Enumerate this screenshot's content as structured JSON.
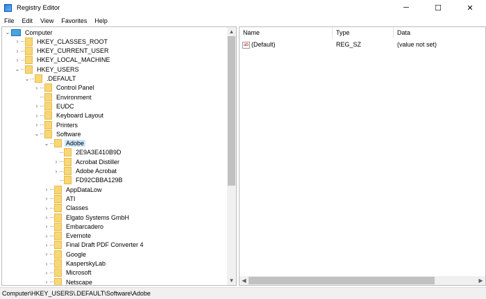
{
  "window": {
    "title": "Registry Editor",
    "minimize": "─",
    "maximize": "☐",
    "close": "✕"
  },
  "menu": [
    "File",
    "Edit",
    "View",
    "Favorites",
    "Help"
  ],
  "tree": [
    {
      "label": "Computer",
      "level": 0,
      "state": "open",
      "icon": "computer"
    },
    {
      "label": "HKEY_CLASSES_ROOT",
      "level": 1,
      "state": "closed"
    },
    {
      "label": "HKEY_CURRENT_USER",
      "level": 1,
      "state": "closed"
    },
    {
      "label": "HKEY_LOCAL_MACHINE",
      "level": 1,
      "state": "closed"
    },
    {
      "label": "HKEY_USERS",
      "level": 1,
      "state": "open"
    },
    {
      "label": ".DEFAULT",
      "level": 2,
      "state": "open"
    },
    {
      "label": "Control Panel",
      "level": 3,
      "state": "closed"
    },
    {
      "label": "Environment",
      "level": 3,
      "state": "leaf"
    },
    {
      "label": "EUDC",
      "level": 3,
      "state": "closed"
    },
    {
      "label": "Keyboard Layout",
      "level": 3,
      "state": "closed"
    },
    {
      "label": "Printers",
      "level": 3,
      "state": "closed"
    },
    {
      "label": "Software",
      "level": 3,
      "state": "open"
    },
    {
      "label": "Adobe",
      "level": 4,
      "state": "open",
      "selected": true
    },
    {
      "label": "2E9A3E410B9D",
      "level": 5,
      "state": "leaf"
    },
    {
      "label": "Acrobat Distiller",
      "level": 5,
      "state": "closed"
    },
    {
      "label": "Adobe Acrobat",
      "level": 5,
      "state": "closed"
    },
    {
      "label": "FD92CBBA129B",
      "level": 5,
      "state": "leaf"
    },
    {
      "label": "AppDataLow",
      "level": 4,
      "state": "closed"
    },
    {
      "label": "ATI",
      "level": 4,
      "state": "closed"
    },
    {
      "label": "Classes",
      "level": 4,
      "state": "closed"
    },
    {
      "label": "Elgato Systems GmbH",
      "level": 4,
      "state": "closed"
    },
    {
      "label": "Embarcadero",
      "level": 4,
      "state": "closed"
    },
    {
      "label": "Evernote",
      "level": 4,
      "state": "closed"
    },
    {
      "label": "Final Draft PDF Converter 4",
      "level": 4,
      "state": "closed"
    },
    {
      "label": "Google",
      "level": 4,
      "state": "closed"
    },
    {
      "label": "KasperskyLab",
      "level": 4,
      "state": "closed"
    },
    {
      "label": "Microsoft",
      "level": 4,
      "state": "closed"
    },
    {
      "label": "Netscape",
      "level": 4,
      "state": "closed"
    }
  ],
  "list": {
    "columns": [
      "Name",
      "Type",
      "Data"
    ],
    "rows": [
      {
        "name": "(Default)",
        "type": "REG_SZ",
        "data": "(value not set)",
        "icon_text": "ab"
      }
    ]
  },
  "status": "Computer\\HKEY_USERS\\.DEFAULT\\Software\\Adobe"
}
